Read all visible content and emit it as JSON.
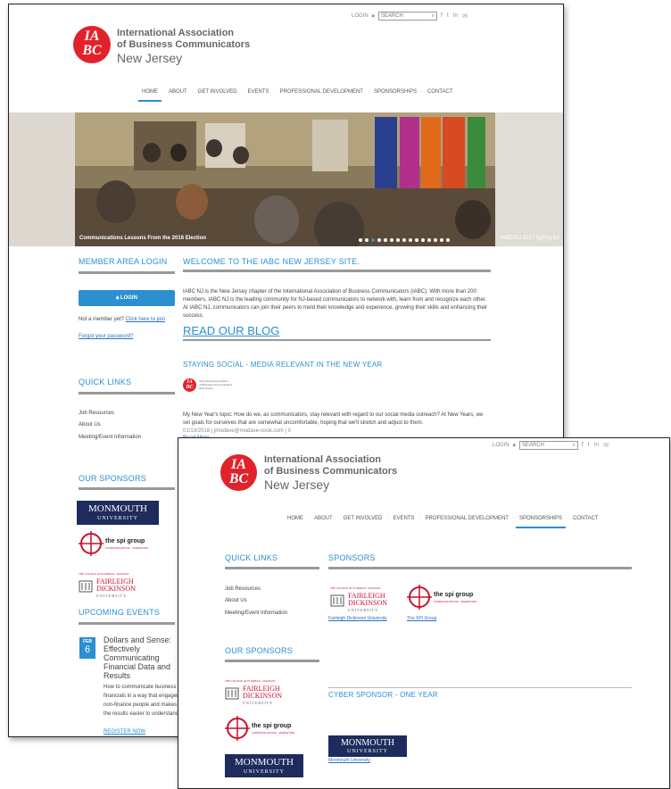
{
  "logo": {
    "letters_top": "IA",
    "letters_bottom": "BC",
    "line1": "International Association",
    "line2": "of Business Communicators",
    "line3": "New Jersey"
  },
  "util": {
    "login": "LOGIN",
    "search_placeholder": "SEARCH",
    "social_icons": [
      "facebook-icon",
      "twitter-icon",
      "linkedin-icon",
      "email-icon"
    ],
    "social_glyphs": [
      "f",
      "t",
      "in",
      "✉"
    ]
  },
  "nav": [
    "HOME",
    "ABOUT",
    "GET INVOLVED",
    "EVENTS",
    "PROFESSIONAL DEVELOPMENT",
    "SPONSORSHIPS",
    "CONTACT"
  ],
  "page1": {
    "active_nav": "HOME",
    "hero": {
      "caption": "Communications Lessons From the 2016 Election",
      "next_caption": "IABC/NJ 2017 Spring Bo",
      "slides": 15,
      "current": 3
    },
    "member_login": {
      "heading": "MEMBER AREA LOGIN",
      "button": "LOGIN",
      "not_member": "Not a member yet?",
      "join_link": "Click here to join",
      "forgot": "Forgot your password?"
    },
    "welcome": {
      "heading": "WELCOME TO THE IABC NEW JERSEY SITE.",
      "body": "IABC NJ is the New Jersey chapter of the International Association of Business Communicators (IABC). With more than 200 members, IABC NJ is the leading community for NJ-based communicators to network with, learn from and recognize each other.  At IABC NJ, communicators can join their peers to meld their knowledge and experience, growing their skills and enhancing their success.",
      "blog_link": "READ OUR BLOG"
    },
    "post": {
      "title": "STAYING SOCIAL - MEDIA RELEVANT IN THE NEW YEAR",
      "body": "My New Year's topic: How do we, as communicators, stay relevant with regard to our social media outreach? At New Years, we set goals for ourselves that are somewhat uncomfortable, hoping that we'll stretch and adjust to them.",
      "meta": "01/13/2018 | jmodave@modave-cook.com | 0",
      "read_more": "Read More"
    },
    "quick_links": {
      "heading": "QUICK LINKS",
      "items": [
        "Job Resources",
        "About Us",
        "Meeting/Event Information"
      ]
    },
    "sponsors_heading": "OUR SPONSORS",
    "upcoming": {
      "heading": "UPCOMING EVENTS",
      "month": "FEB",
      "day": "6",
      "title": "Dollars and Sense: Effectively Communicating Financial Data and Results",
      "desc": "How to communicate business financials in a way that engages non-finance people and makes the results easier to understand.",
      "register": "REGISTER NOW"
    }
  },
  "page2": {
    "active_nav": "SPONSORSHIPS",
    "quick_links": {
      "heading": "QUICK LINKS",
      "items": [
        "Job Resources",
        "About Us",
        "Meeting/Event Information"
      ]
    },
    "our_sponsors": "OUR SPONSORS",
    "sponsors": {
      "heading": "SPONSORS",
      "fdu_caption": "Fairleigh Dickinson University",
      "spi_caption": "The SPI Group"
    },
    "cyber": {
      "heading": "CYBER SPONSOR - ONE YEAR",
      "mon_caption": "Monmouth University"
    }
  },
  "logos": {
    "monmouth_1": "MONMOUTH",
    "monmouth_2": "UNIVERSITY",
    "fdu_top": "THE COLLEGE AT FLORHAM · MADISON",
    "fdu_1": "FAIRLEIGH",
    "fdu_2": "DICKINSON",
    "fdu_3": "UNIVERSITY",
    "spi": "the spi group",
    "spi_sub": "COMMUNICATIONS · MARKETING",
    "iabc_small_1": "International Association",
    "iabc_small_2": "of Business Communicators",
    "iabc_small_3": "New Jersey"
  },
  "colors": {
    "accent": "#2b8fd0",
    "logo_red": "#e2222b",
    "monmouth_navy": "#1d2c5c"
  }
}
